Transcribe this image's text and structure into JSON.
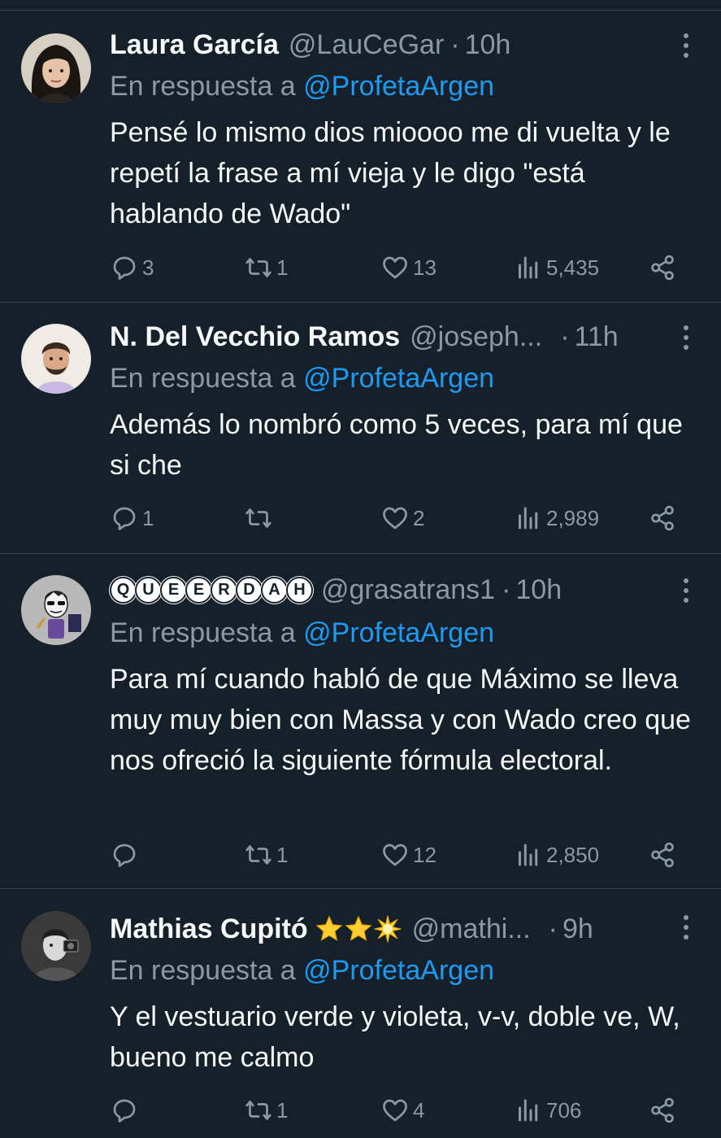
{
  "reply_prefix": "En respuesta a",
  "colors": {
    "background": "#15202b",
    "text": "#f7f9f9",
    "muted": "#8b98a5",
    "mention": "#1d9bf0",
    "divider": "#38444d"
  },
  "icons": [
    "reply-icon",
    "retweet-icon",
    "like-icon",
    "views-icon",
    "share-icon",
    "more-icon"
  ],
  "tweets": [
    {
      "name": "Laura García",
      "handle": "@LauCeGar",
      "dot": "·",
      "time": "10h",
      "reply_to": "@ProfetaArgen",
      "text": "Pensé lo mismo dios mioooo me di vuelta y le repetí la frase a mí vieja y le digo \"está hablando de Wado\"",
      "replies": "3",
      "retweets": "1",
      "likes": "13",
      "views": "5,435"
    },
    {
      "name": "N. Del Vecchio Ramos",
      "handle": "@joseph...",
      "dot": "·",
      "time": "11h",
      "reply_to": "@ProfetaArgen",
      "text": "Además lo nombró como 5 veces, para mí que si che",
      "replies": "1",
      "retweets": "",
      "likes": "2",
      "views": "2,989"
    },
    {
      "name_letters": [
        "Q",
        "U",
        "E",
        "E",
        "R",
        "D",
        "A",
        "H"
      ],
      "handle": "@grasatrans1",
      "dot": "·",
      "time": "10h",
      "reply_to": "@ProfetaArgen",
      "text": "Para mí cuando habló de que Máximo se lleva muy muy bien con Massa y con Wado creo que nos ofreció la siguiente fórmula electoral.",
      "replies": "",
      "retweets": "1",
      "likes": "12",
      "views": "2,850"
    },
    {
      "name": "Mathias Cupitó",
      "handle": "@mathi...",
      "dot": "·",
      "time": "9h",
      "reply_to": "@ProfetaArgen",
      "text": "Y el vestuario verde y violeta, v-v, doble ve, W, bueno me calmo",
      "replies": "",
      "retweets": "1",
      "likes": "4",
      "views": "706"
    }
  ]
}
